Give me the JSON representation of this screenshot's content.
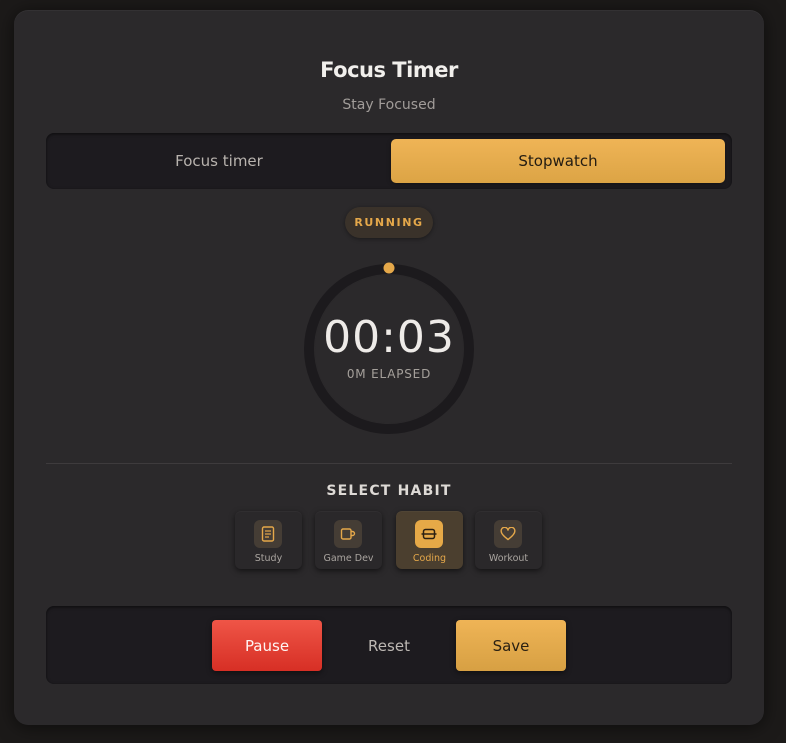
{
  "header": {
    "title": "Focus Timer",
    "subtitle": "Stay Focused"
  },
  "mode_toggle": {
    "tabs": [
      {
        "label": "Focus timer",
        "active": false
      },
      {
        "label": "Stopwatch",
        "active": true
      }
    ]
  },
  "status": {
    "label": "RUNNING"
  },
  "timer": {
    "time": "00:03",
    "elapsed_label": "0M ELAPSED"
  },
  "habits": {
    "section_label": "SELECT HABIT",
    "items": [
      {
        "label": "Study",
        "icon": "book-icon",
        "selected": false
      },
      {
        "label": "Game Dev",
        "icon": "mug-icon",
        "selected": false
      },
      {
        "label": "Coding",
        "icon": "dumbbell-icon",
        "selected": true
      },
      {
        "label": "Workout",
        "icon": "heart-icon",
        "selected": false
      }
    ]
  },
  "controls": {
    "pause_label": "Pause",
    "reset_label": "Reset",
    "save_label": "Save"
  },
  "colors": {
    "accent": "#e5a84a",
    "danger": "#e04134",
    "card_bg": "#2b292b",
    "panel_bg": "#1d1b1f"
  }
}
